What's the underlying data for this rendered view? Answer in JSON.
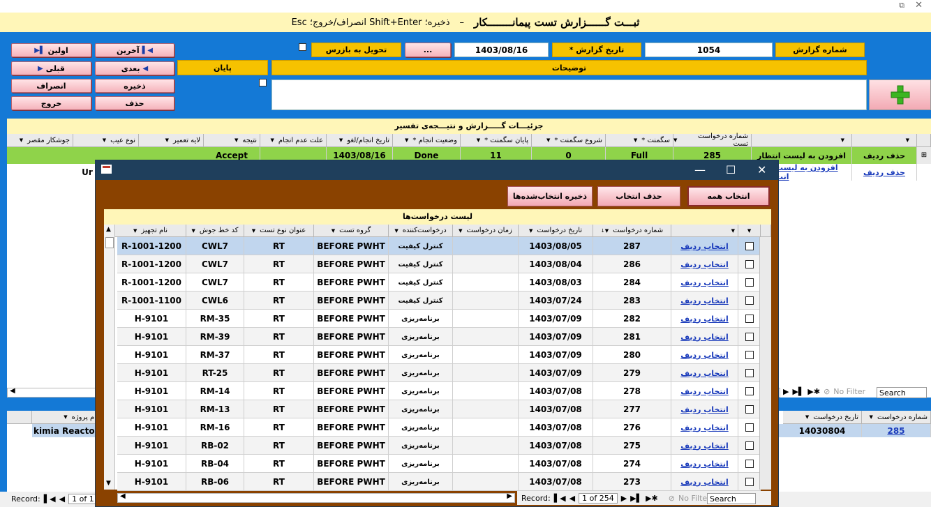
{
  "window": {
    "restore_glyph": "⧉",
    "close_glyph": "✕"
  },
  "title": {
    "main": "ثبـــت گــــــزارش تست پیمانــــــــکار",
    "dash": "–",
    "hint": "ذخیره؛ Shift+Enter  انصراف/خروج؛ Esc"
  },
  "buttons": {
    "first": "اولین",
    "last": "آخرین",
    "prev": "قبلی",
    "next": "بعدی",
    "cancel": "انصراف",
    "save": "ذخیره",
    "exit": "خروج",
    "delete": "حذف",
    "ellipsis": "..."
  },
  "form": {
    "report_number_label": "شماره گزارش",
    "report_number_value": "1054",
    "report_date_label": "* تاریخ گزارش",
    "report_date_value": "1403/08/16",
    "deliver_label": "تحویل به بازرس",
    "end_label": "پایان",
    "description_label": "توضیحات"
  },
  "details": {
    "title": "جزئیـــات گـــــزارش و نتیـــجه‌ی تفسیر",
    "columns": [
      "",
      "",
      "شماره درخواست تست",
      "سگمنت *",
      "شروع سگمنت *",
      "پایان سگمنت *",
      "وضعیت انجام *",
      "تاریخ انجام/لغو",
      "علت عدم انجام",
      "نتیجه",
      "لایه تعمیر",
      "نوع عیب",
      "جوشکار مقصر"
    ],
    "row1": {
      "delete": "حذف ردیف",
      "add_wait": "افزودن به لیست انتظار",
      "request": "285",
      "segment": "Full",
      "start": "0",
      "end": "11",
      "status": "Done",
      "date": "1403/08/16",
      "result": "Accept"
    },
    "row2": {
      "delete": "حذف ردیف",
      "add_wait": "افزودن به لیست انت",
      "partial": "Ur"
    }
  },
  "footer_top": {
    "no_filter": "No Filter",
    "search": "Search"
  },
  "bottom": {
    "col_request": "شماره درخواست",
    "col_request_date": "تاریخ درخواست",
    "col_project": "نام پروژه",
    "request_value": "285",
    "date_value": "14030804",
    "project_value": "kimia Reactor",
    "record_label": "Record:",
    "record_pos": "1 of 1"
  },
  "dialog": {
    "select_all": "انتخاب همه",
    "delete_selection": "حذف انتخاب",
    "save_selected": "ذخیره انتخاب‌شده‌ها",
    "list_title": "لیست درخواست‌ها",
    "columns": [
      "",
      "",
      "شماره درخواست",
      "تاریخ درخواست",
      "زمان درخواست",
      "درخواست‌کننده",
      "گروه تست",
      "عنوان نوع تست",
      "کد خط جوش",
      "نام تجهیز"
    ],
    "select_link": "انتخاب ردیف",
    "rows": [
      {
        "num": "287",
        "date": "1403/08/05",
        "by": "کنترل کیفیت",
        "group": "BEFORE PWHT",
        "type": "RT",
        "line": "CWL7",
        "equip": "R-1001-1200"
      },
      {
        "num": "286",
        "date": "1403/08/04",
        "by": "کنترل کیفیت",
        "group": "BEFORE PWHT",
        "type": "RT",
        "line": "CWL7",
        "equip": "R-1001-1200"
      },
      {
        "num": "284",
        "date": "1403/08/03",
        "by": "کنترل کیفیت",
        "group": "BEFORE PWHT",
        "type": "RT",
        "line": "CWL7",
        "equip": "R-1001-1200"
      },
      {
        "num": "283",
        "date": "1403/07/24",
        "by": "کنترل کیفیت",
        "group": "BEFORE PWHT",
        "type": "RT",
        "line": "CWL6",
        "equip": "R-1001-1100"
      },
      {
        "num": "282",
        "date": "1403/07/09",
        "by": "برنامه‌ریزی",
        "group": "BEFORE PWHT",
        "type": "RT",
        "line": "RM-35",
        "equip": "H-9101"
      },
      {
        "num": "281",
        "date": "1403/07/09",
        "by": "برنامه‌ریزی",
        "group": "BEFORE PWHT",
        "type": "RT",
        "line": "RM-39",
        "equip": "H-9101"
      },
      {
        "num": "280",
        "date": "1403/07/09",
        "by": "برنامه‌ریزی",
        "group": "BEFORE PWHT",
        "type": "RT",
        "line": "RM-37",
        "equip": "H-9101"
      },
      {
        "num": "279",
        "date": "1403/07/09",
        "by": "برنامه‌ریزی",
        "group": "BEFORE PWHT",
        "type": "RT",
        "line": "RT-25",
        "equip": "H-9101"
      },
      {
        "num": "278",
        "date": "1403/07/08",
        "by": "برنامه‌ریزی",
        "group": "BEFORE PWHT",
        "type": "RT",
        "line": "RM-14",
        "equip": "H-9101"
      },
      {
        "num": "277",
        "date": "1403/07/08",
        "by": "برنامه‌ریزی",
        "group": "BEFORE PWHT",
        "type": "RT",
        "line": "RM-13",
        "equip": "H-9101"
      },
      {
        "num": "276",
        "date": "1403/07/08",
        "by": "برنامه‌ریزی",
        "group": "BEFORE PWHT",
        "type": "RT",
        "line": "RM-16",
        "equip": "H-9101"
      },
      {
        "num": "275",
        "date": "1403/07/08",
        "by": "برنامه‌ریزی",
        "group": "BEFORE PWHT",
        "type": "RT",
        "line": "RB-02",
        "equip": "H-9101"
      },
      {
        "num": "274",
        "date": "1403/07/08",
        "by": "برنامه‌ریزی",
        "group": "BEFORE PWHT",
        "type": "RT",
        "line": "RB-04",
        "equip": "H-9101"
      },
      {
        "num": "273",
        "date": "1403/07/08",
        "by": "برنامه‌ریزی",
        "group": "BEFORE PWHT",
        "type": "RT",
        "line": "RB-06",
        "equip": "H-9101"
      }
    ],
    "record_label": "Record:",
    "record_pos": "1 of 254",
    "no_filter": "No Filter",
    "search": "Search"
  }
}
